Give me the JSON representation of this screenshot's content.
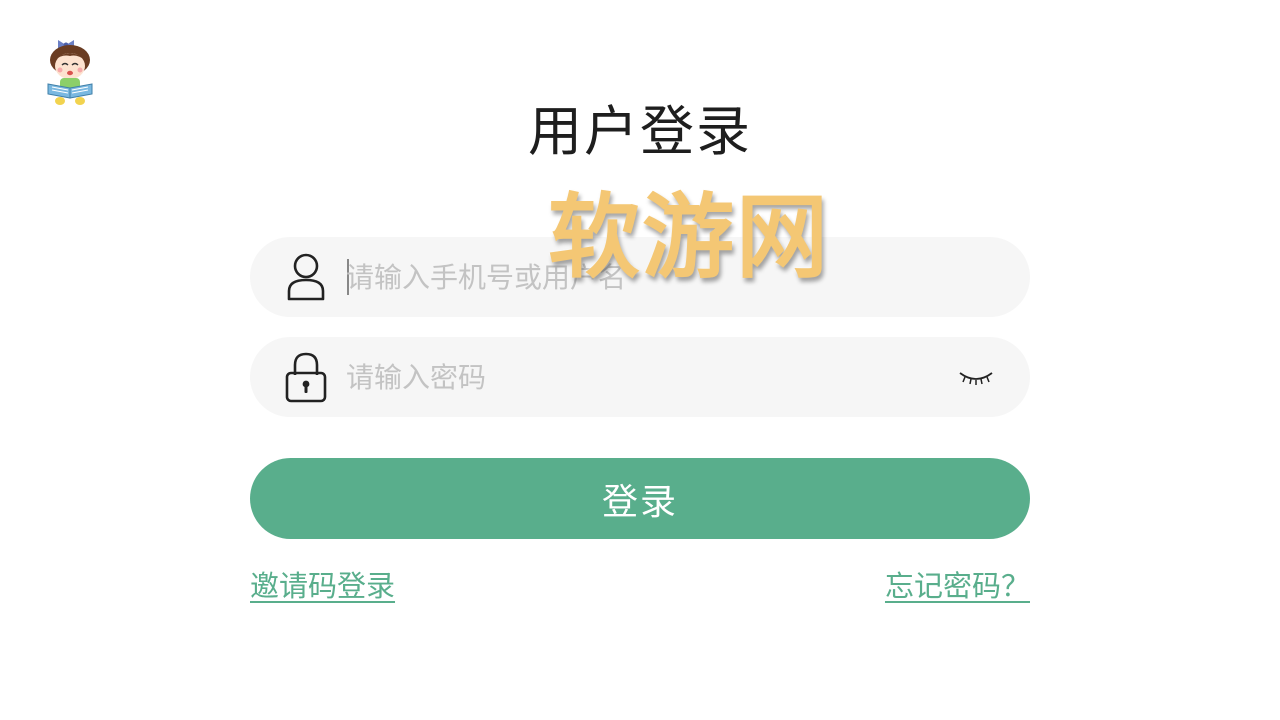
{
  "title": "用户登录",
  "username": {
    "value": "",
    "placeholder": "请输入手机号或用户名"
  },
  "password": {
    "value": "",
    "placeholder": "请输入密码"
  },
  "login_button": "登录",
  "invite_code_link": "邀请码登录",
  "forgot_password_link": "忘记密码？",
  "watermark": "软游网",
  "colors": {
    "accent": "#59ae8c",
    "field_background": "#f6f6f6",
    "title_text": "#1e1e1e",
    "placeholder": "#c3c3c3"
  },
  "icons": {
    "mascot": "girl-reading-book-icon",
    "username": "user-icon",
    "password": "lock-icon",
    "visibility": "eye-closed-icon"
  }
}
